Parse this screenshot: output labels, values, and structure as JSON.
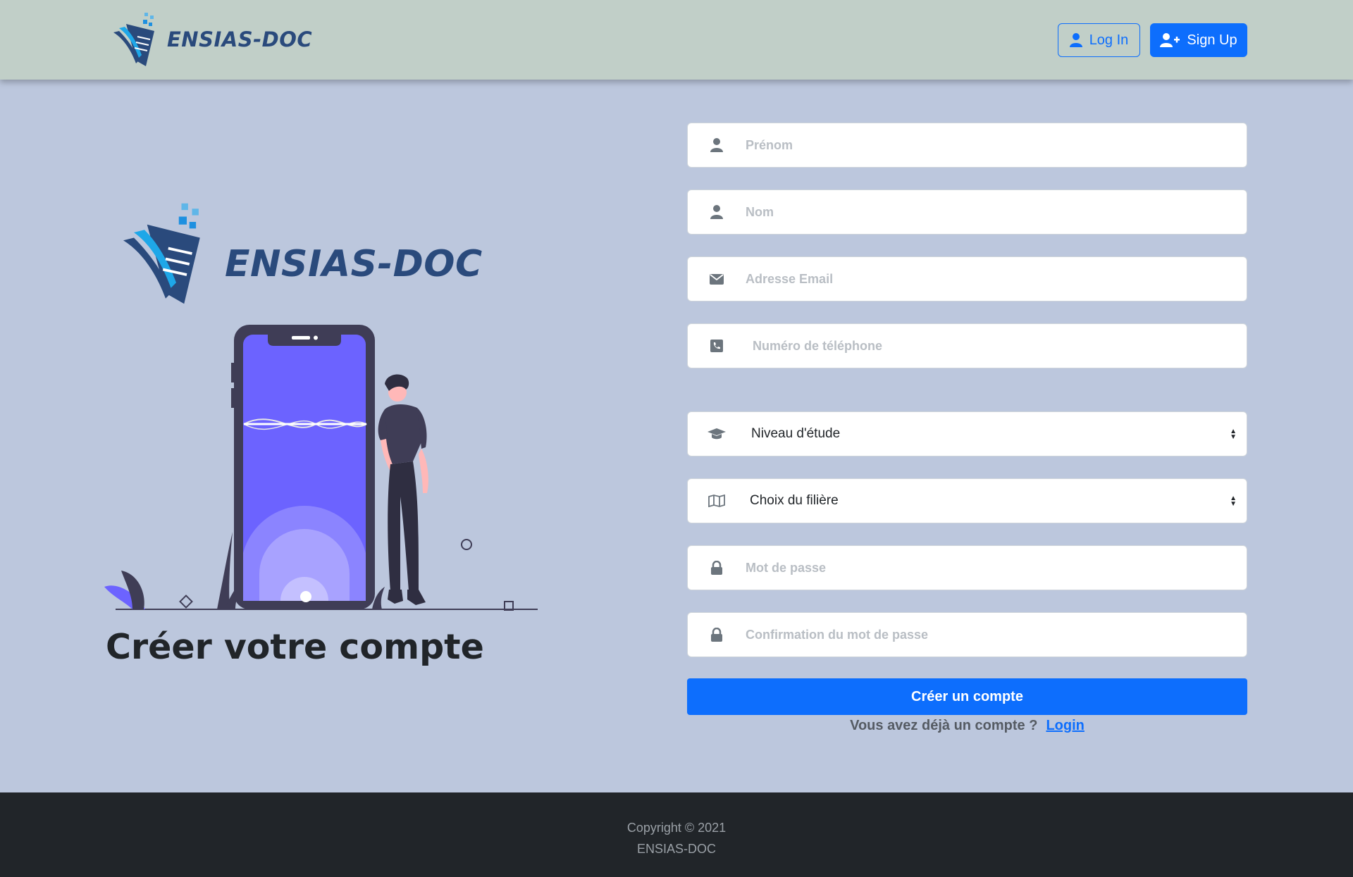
{
  "brand": {
    "name": "ENSIAS-DOC"
  },
  "nav": {
    "login_label": "Log In",
    "signup_label": "Sign Up"
  },
  "hero": {
    "title": "Créer votre compte"
  },
  "form": {
    "prenom_placeholder": "Prénom",
    "nom_placeholder": "Nom",
    "email_placeholder": "Adresse Email",
    "phone_placeholder": "Numéro de téléphone",
    "niveau_selected": "Niveau d'étude",
    "filiere_selected": "Choix du filière",
    "password_placeholder": "Mot de passe",
    "confirm_placeholder": "Confirmation du mot de passe",
    "submit_label": "Créer un compte",
    "already_text": "Vous avez déjà un compte ?",
    "login_link": "Login"
  },
  "footer": {
    "copyright": "Copyright © 2021",
    "name": "ENSIAS-DOC"
  },
  "icons": [
    "user-icon",
    "user-plus-icon",
    "envelope-icon",
    "phone-icon",
    "graduation-cap-icon",
    "map-icon",
    "lock-icon"
  ],
  "colors": {
    "primary": "#0d6efd",
    "navbar": "#c1cfc8",
    "background": "#bcc7dd",
    "footer": "#212529",
    "brand": "#2a4a7c"
  }
}
